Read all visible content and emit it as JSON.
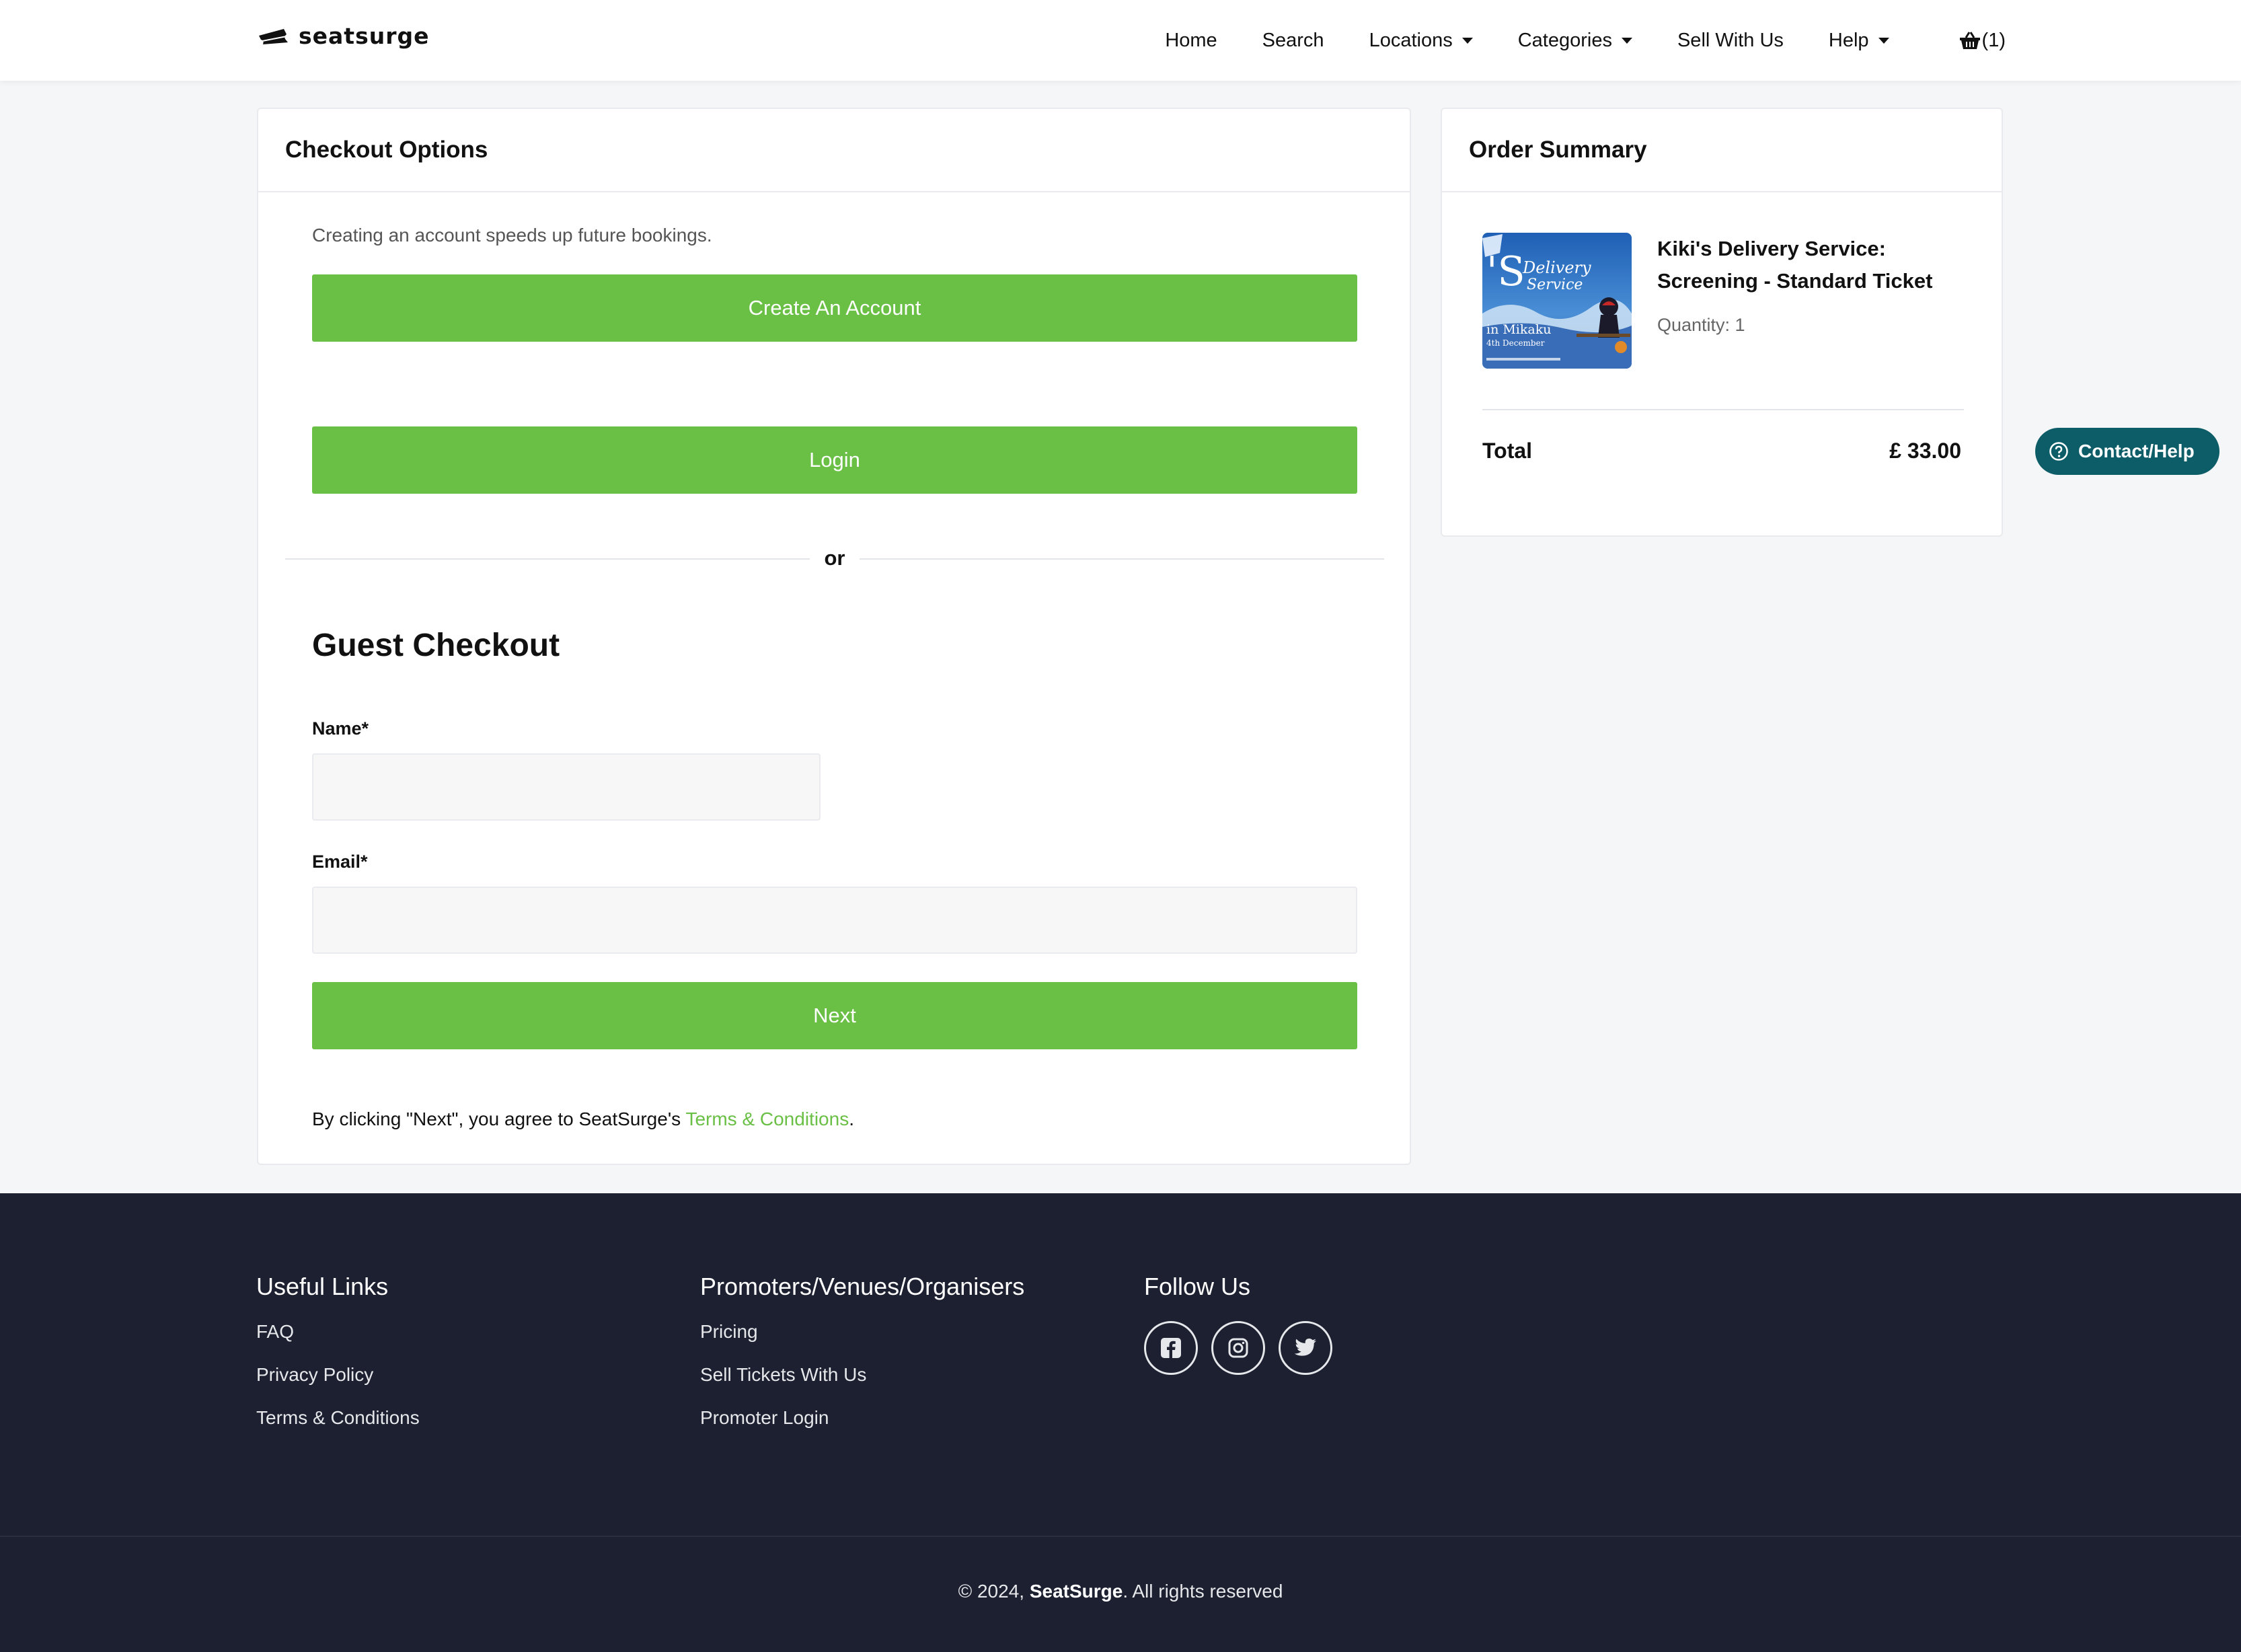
{
  "brand": {
    "name": "seatsurge"
  },
  "nav": {
    "items": [
      {
        "label": "Home",
        "has_caret": false
      },
      {
        "label": "Search",
        "has_caret": false
      },
      {
        "label": "Locations",
        "has_caret": true
      },
      {
        "label": "Categories",
        "has_caret": true
      },
      {
        "label": "Sell With Us",
        "has_caret": false
      },
      {
        "label": "Help",
        "has_caret": true
      }
    ],
    "cart_count": "(1)",
    "cart_icon": "basket-icon"
  },
  "checkout": {
    "title": "Checkout Options",
    "helper": "Creating an account speeds up future bookings.",
    "create_account_label": "Create An Account",
    "login_label": "Login",
    "divider_text": "or",
    "guest_title": "Guest Checkout",
    "name_label": "Name*",
    "name_value": "",
    "email_label": "Email*",
    "email_value": "",
    "next_label": "Next",
    "terms_prefix": "By clicking \"Next\", you agree to SeatSurge's ",
    "terms_link": "Terms & Conditions",
    "terms_suffix": "."
  },
  "summary": {
    "title": "Order Summary",
    "item_title": "Kiki's Delivery Service: Screening - Standard Ticket",
    "quantity": "Quantity: 1",
    "poster_text_a": "Delivery",
    "poster_text_b": "Service",
    "poster_text_c": "in Mikaku",
    "poster_text_d": "4th December",
    "total_label": "Total",
    "total_value": "£ 33.00"
  },
  "contact": {
    "label": "Contact/Help",
    "icon": "question-circle-icon"
  },
  "footer": {
    "useful": {
      "title": "Useful Links",
      "links": [
        "FAQ",
        "Privacy Policy",
        "Terms & Conditions"
      ]
    },
    "promoters": {
      "title": "Promoters/Venues/Organisers",
      "links": [
        "Pricing",
        "Sell Tickets With Us",
        "Promoter Login"
      ]
    },
    "follow": {
      "title": "Follow Us",
      "icons": [
        "facebook-icon",
        "instagram-icon",
        "twitter-icon"
      ]
    },
    "copyright_prefix": "© 2024, ",
    "copyright_brand": "SeatSurge",
    "copyright_suffix": ". All rights reserved"
  },
  "colors": {
    "accent": "#6abf45",
    "footer_bg": "#1c2030",
    "contact_bg": "#0d5d68"
  }
}
